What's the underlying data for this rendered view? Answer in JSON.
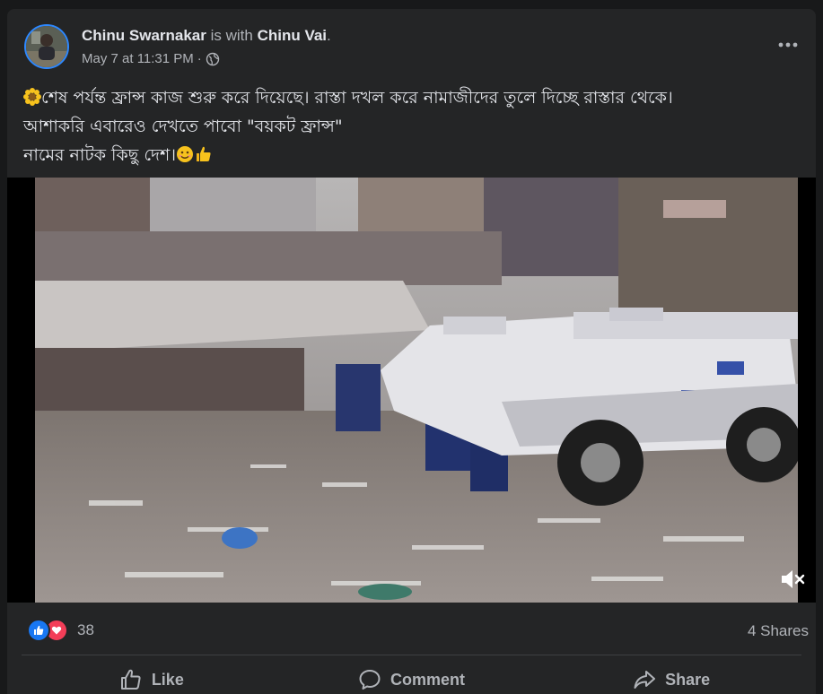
{
  "post": {
    "author": "Chinu Swarnakar",
    "with_text": "is with",
    "tagged": "Chinu Vai",
    "period": ".",
    "date": "May 7 at 11:31 PM",
    "separator": "·",
    "privacy_icon": "globe-icon",
    "text_line1": "শেষ পর্যন্ত ফ্রান্স কাজ শুরু করে দিয়েছে। রাস্তা দখল করে নামাজীদের তুলে দিচ্ছে রাস্তার থেকে।",
    "text_line2": "আশাকরি এবারেও দেখতে পাবো \"বয়কট ফ্রান্স\"",
    "text_line3": "নামের নাটক কিছু দেশ।",
    "emojis": [
      "sunflower-emoji",
      "smile-emoji",
      "thumbs-up-emoji"
    ]
  },
  "video": {
    "mute_icon": "speaker-muted-icon"
  },
  "stats": {
    "reaction_icons": [
      "like-reaction-icon",
      "love-reaction-icon"
    ],
    "reaction_count": "38",
    "shares": "4 Shares"
  },
  "actions": {
    "like": "Like",
    "comment": "Comment",
    "share": "Share"
  },
  "colors": {
    "card_bg": "#242526",
    "page_bg": "#18191a",
    "primary_text": "#e4e6eb",
    "secondary_text": "#b0b3b8",
    "like_blue": "#1877f2",
    "love_red": "#f33e58"
  }
}
